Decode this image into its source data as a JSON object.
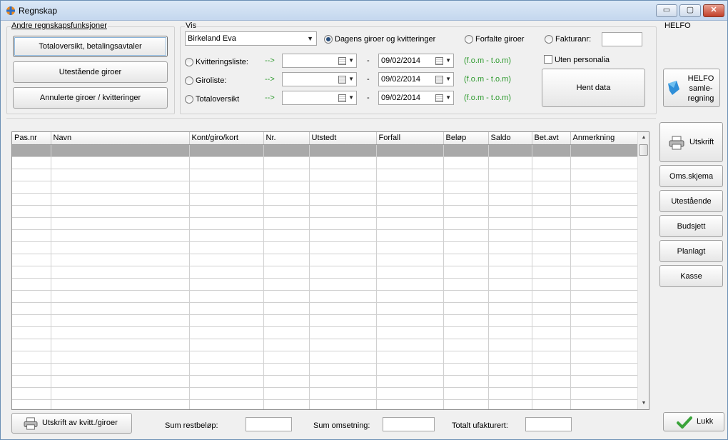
{
  "window": {
    "title": "Regnskap",
    "controls": {
      "minimize": "▭",
      "maximize": "▢",
      "close": "✕"
    }
  },
  "left_panel": {
    "title": "Andre regnskapsfunksjoner",
    "buttons": [
      "Totaloversikt, betalingsavtaler",
      "Utestående giroer",
      "Annulerte giroer / kvitteringer"
    ]
  },
  "vis_panel": {
    "title": "Vis",
    "person_select": "Birkeland Eva",
    "radio_dagens": "Dagens giroer og kvitteringer",
    "radio_forfalte": "Forfalte giroer",
    "radio_fakturanr": "Fakturanr:",
    "fakturanr_value": "",
    "checkbox_uten_personalia": "Uten personalia",
    "fetch_button": "Hent data",
    "rows": [
      {
        "label": "Kvitteringsliste:",
        "arrow": "-->",
        "from": "",
        "dash": "-",
        "to": "09/02/2014",
        "hint": "(f.o.m - t.o.m)"
      },
      {
        "label": "Giroliste:",
        "arrow": "-->",
        "from": "",
        "dash": "-",
        "to": "09/02/2014",
        "hint": "(f.o.m - t.o.m)"
      },
      {
        "label": "Totaloversikt",
        "arrow": "-->",
        "from": "",
        "dash": "-",
        "to": "09/02/2014",
        "hint": "(f.o.m - t.o.m)"
      }
    ]
  },
  "helfo": {
    "title": "HELFO",
    "button_line1": "HELFO",
    "button_line2": "samle-",
    "button_line3": "regning"
  },
  "table": {
    "columns": [
      "Pas.nr",
      "Navn",
      "Kont/giro/kort",
      "Nr.",
      "Utstedt",
      "Forfall",
      "Beløp",
      "Saldo",
      "Bet.avt",
      "Anmerkning"
    ],
    "empty_rows": 22
  },
  "side_buttons": {
    "print": "Utskrift",
    "items": [
      "Oms.skjema",
      "Utestående",
      "Budsjett",
      "Planlagt",
      "Kasse"
    ]
  },
  "footer": {
    "print_button": "Utskrift av kvitt./giroer",
    "sum_rest_label": "Sum restbeløp:",
    "sum_rest_value": "",
    "sum_oms_label": "Sum omsetning:",
    "sum_oms_value": "",
    "total_unbilled_label": "Totalt ufakturert:",
    "total_unbilled_value": "",
    "close_button": "Lukk"
  }
}
